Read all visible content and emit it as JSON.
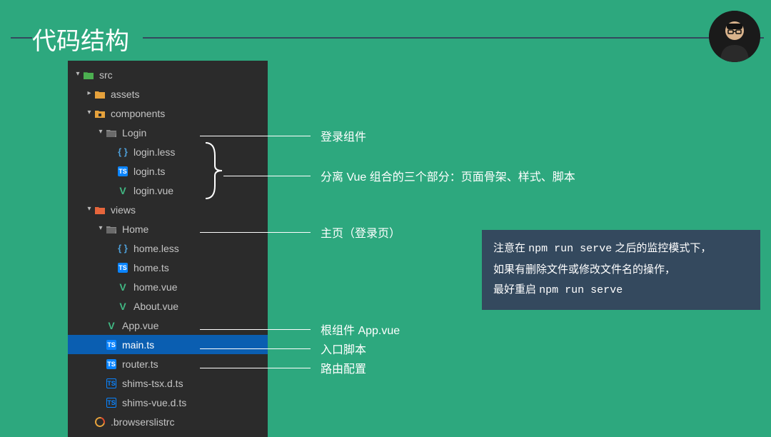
{
  "title": "代码结构",
  "tree": {
    "src": "src",
    "assets": "assets",
    "components": "components",
    "login_folder": "Login",
    "login_less": "login.less",
    "login_ts": "login.ts",
    "login_vue": "login.vue",
    "views": "views",
    "home_folder": "Home",
    "home_less": "home.less",
    "home_ts": "home.ts",
    "home_vue": "home.vue",
    "about_vue": "About.vue",
    "app_vue": "App.vue",
    "main_ts": "main.ts",
    "router_ts": "router.ts",
    "shims_tsx": "shims-tsx.d.ts",
    "shims_vue": "shims-vue.d.ts",
    "browserslistrc": ".browserslistrc"
  },
  "callouts": {
    "login": "登录组件",
    "split": "分离 Vue 组合的三个部分：页面骨架、样式、脚本",
    "home": "主页（登录页）",
    "app": "根组件 App.vue",
    "main": "入口脚本",
    "router": "路由配置"
  },
  "note": {
    "line1_prefix": "注意在 ",
    "line1_code": "npm run serve",
    "line1_suffix": " 之后的监控模式下，",
    "line2": "如果有删除文件或修改文件名的操作，",
    "line3_prefix": "最好重启 ",
    "line3_code": "npm run serve"
  }
}
